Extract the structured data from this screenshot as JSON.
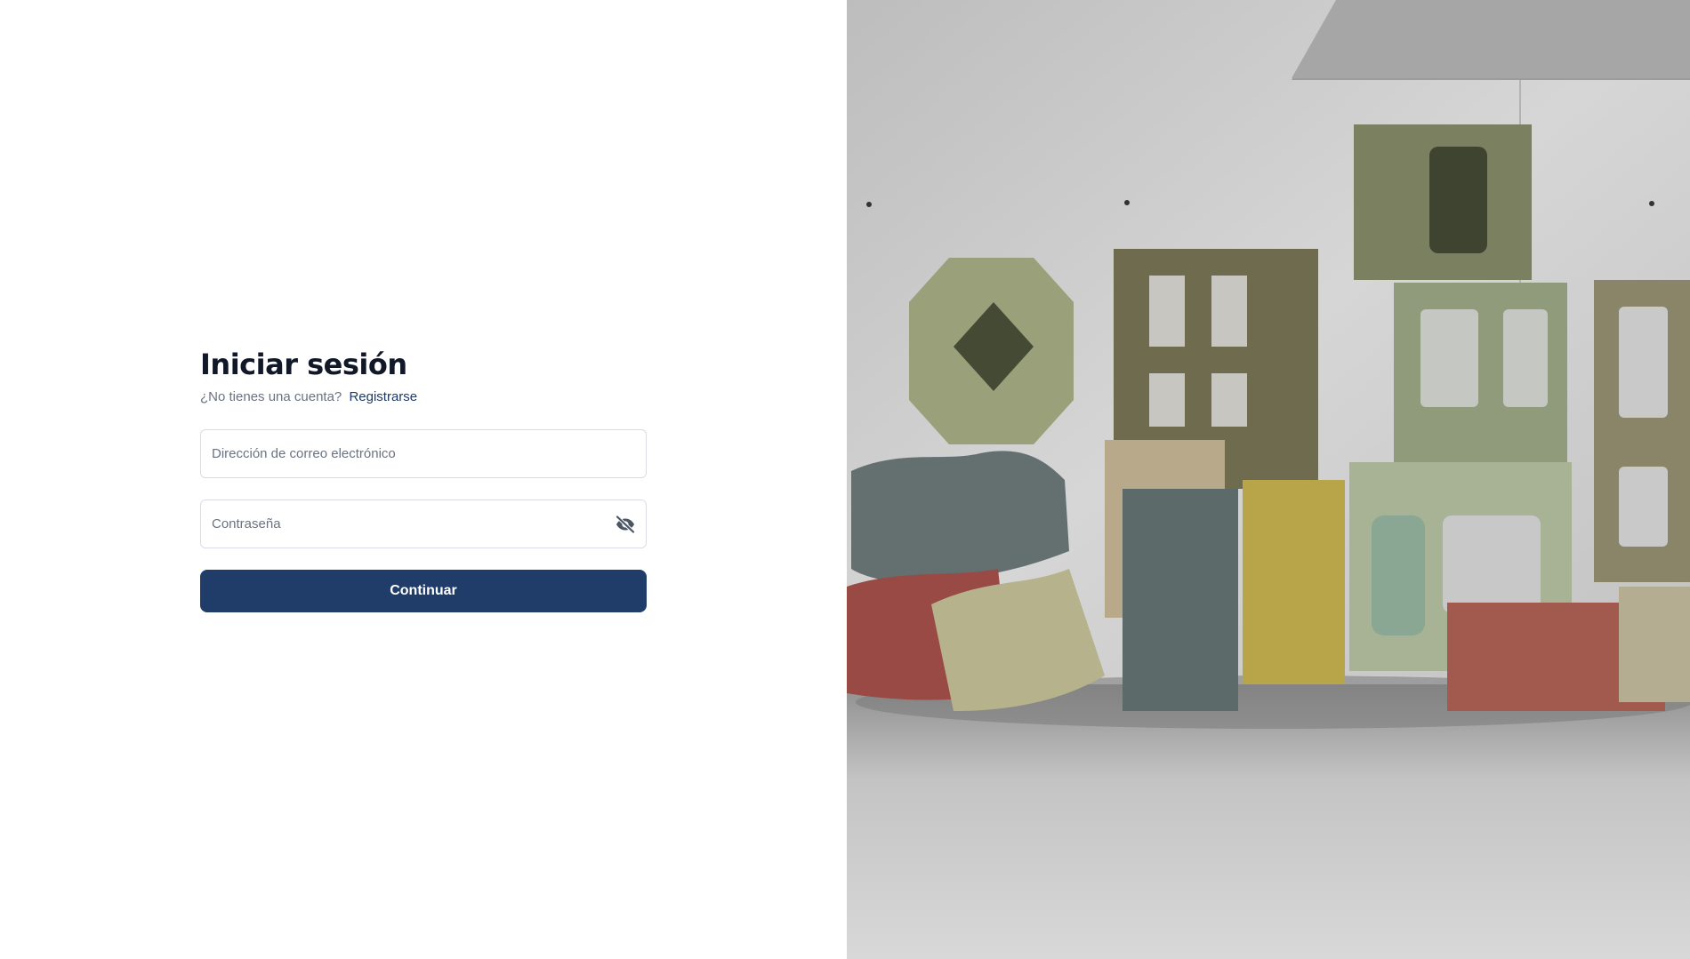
{
  "login": {
    "title": "Iniciar sesión",
    "no_account_text": "¿No tienes una cuenta?",
    "register_link": "Registrarse",
    "email_placeholder": "Dirección de correo electrónico",
    "password_placeholder": "Contraseña",
    "toggle_icon": "eye-off-icon",
    "submit_label": "Continuar"
  },
  "hero": {
    "image": "concrete-blocks-photo"
  },
  "colors": {
    "primary": "#1f3d68",
    "link": "#1f3a64",
    "title": "#111827",
    "muted": "#6b7280",
    "border": "#d9dde3"
  }
}
